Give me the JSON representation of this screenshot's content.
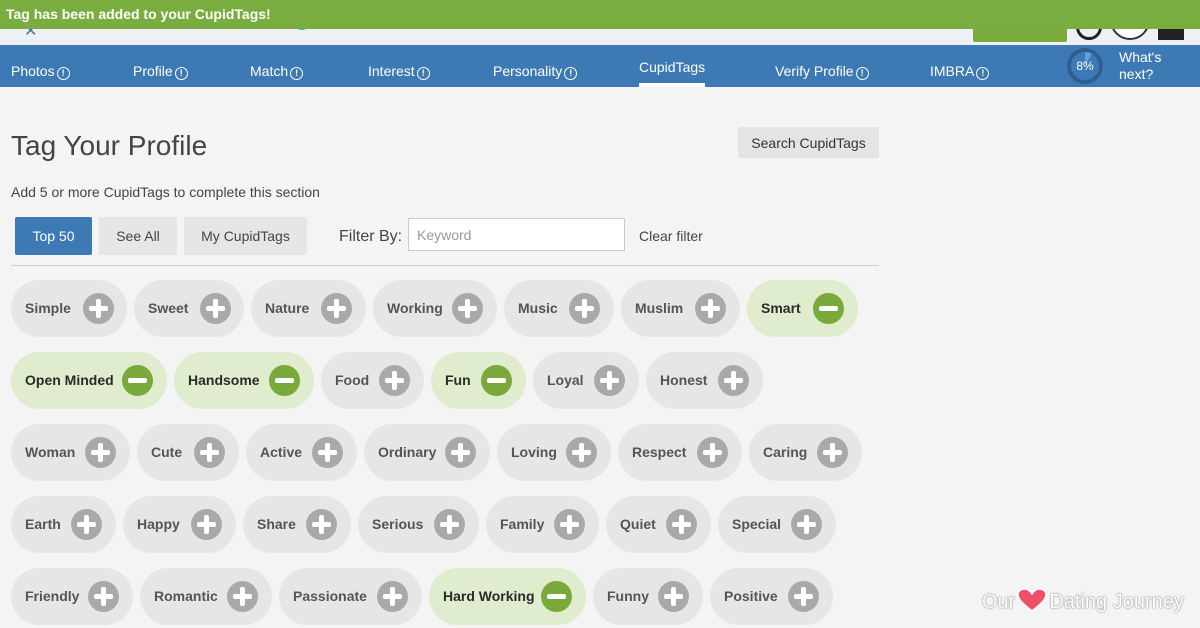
{
  "toast": {
    "message": "Tag has been added to your CupidTags!"
  },
  "nav": {
    "items": [
      {
        "label": "Photos",
        "info": "!"
      },
      {
        "label": "Profile",
        "info": "!"
      },
      {
        "label": "Match",
        "info": "!"
      },
      {
        "label": "Interest",
        "info": "!"
      },
      {
        "label": "Personality",
        "info": "!"
      },
      {
        "label": "CupidTags",
        "info": ""
      },
      {
        "label": "Verify Profile",
        "info": "!"
      },
      {
        "label": "IMBRA",
        "info": "!"
      }
    ],
    "active": "CupidTags",
    "progress": "8%",
    "progress_value": 0.08,
    "whats_next": "What's next?"
  },
  "main": {
    "title": "Tag Your Profile",
    "search_button": "Search CupidTags",
    "subtitle": "Add 5 or more CupidTags to complete this section",
    "tabs": [
      "Top 50",
      "See All",
      "My CupidTags"
    ],
    "filter_label": "Filter By:",
    "filter_placeholder": "Keyword",
    "clear_filter": "Clear filter"
  },
  "tags": [
    [
      {
        "label": "Simple",
        "selected": false
      },
      {
        "label": "Sweet",
        "selected": false
      },
      {
        "label": "Nature",
        "selected": false
      },
      {
        "label": "Working",
        "selected": false
      },
      {
        "label": "Music",
        "selected": false
      },
      {
        "label": "Muslim",
        "selected": false
      },
      {
        "label": "Smart",
        "selected": true
      }
    ],
    [
      {
        "label": "Open Minded",
        "selected": true
      },
      {
        "label": "Handsome",
        "selected": true
      },
      {
        "label": "Food",
        "selected": false
      },
      {
        "label": "Fun",
        "selected": true
      },
      {
        "label": "Loyal",
        "selected": false
      },
      {
        "label": "Honest",
        "selected": false
      }
    ],
    [
      {
        "label": "Woman",
        "selected": false
      },
      {
        "label": "Cute",
        "selected": false
      },
      {
        "label": "Active",
        "selected": false
      },
      {
        "label": "Ordinary",
        "selected": false
      },
      {
        "label": "Loving",
        "selected": false
      },
      {
        "label": "Respect",
        "selected": false
      },
      {
        "label": "Caring",
        "selected": false
      }
    ],
    [
      {
        "label": "Earth",
        "selected": false
      },
      {
        "label": "Happy",
        "selected": false
      },
      {
        "label": "Share",
        "selected": false
      },
      {
        "label": "Serious",
        "selected": false
      },
      {
        "label": "Family",
        "selected": false
      },
      {
        "label": "Quiet",
        "selected": false
      },
      {
        "label": "Special",
        "selected": false
      }
    ],
    [
      {
        "label": "Friendly",
        "selected": false
      },
      {
        "label": "Romantic",
        "selected": false
      },
      {
        "label": "Passionate",
        "selected": false
      },
      {
        "label": "Hard Working",
        "selected": true
      },
      {
        "label": "Funny",
        "selected": false
      },
      {
        "label": "Positive",
        "selected": false
      }
    ]
  ],
  "watermark": {
    "left": "Our",
    "right": "Dating Journey"
  },
  "colors": {
    "toast": "#7aad3f",
    "nav": "#3d7ab5",
    "selected_tag": "#dfeccd",
    "selected_btn": "#79a93a",
    "tag_bg": "#e6e6e6"
  }
}
